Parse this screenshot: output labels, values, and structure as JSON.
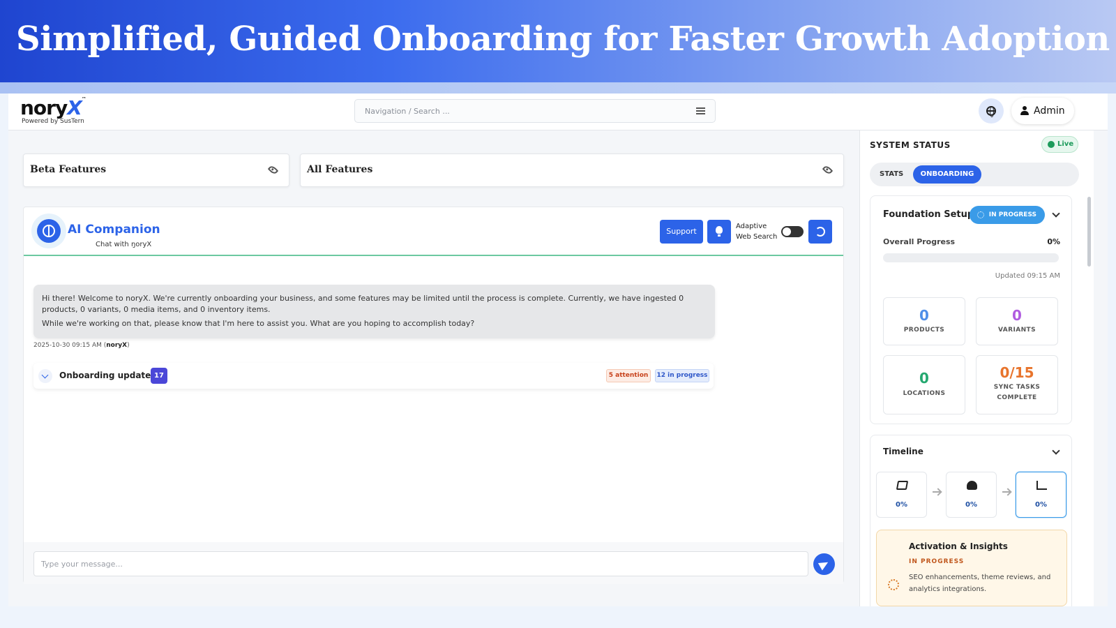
{
  "banner": {
    "title": "Simplified, Guided Onboarding for Faster Growth Adoption"
  },
  "header": {
    "logo_main": "nory",
    "logo_x": "X",
    "logo_tm": "™",
    "logo_sub": "Powered by SusTern",
    "search_placeholder": "Navigation / Search ...",
    "admin_label": "Admin"
  },
  "features": {
    "beta_label": "Beta Features",
    "all_label": "All Features"
  },
  "chat": {
    "title": "AI Companion",
    "subtitle": "Chat with ŋoryX",
    "support_label": "Support",
    "adaptive_label": "Adaptive Web Search",
    "adaptive_on": false,
    "message_line1": "Hi there! Welcome to noryX. We're currently onboarding your business, and some features may be limited until the process is complete. Currently, we have ingested 0 products, 0 variants, 0 media items, and 0 inventory items.",
    "message_line2": "While we're working on that, please know that I'm here to assist you. What are you hoping to accomplish today?",
    "meta_time": "2025-10-30 09:15 AM (",
    "meta_author": "noryX",
    "meta_close": ")",
    "updates_label": "Onboarding updates",
    "updates_count": "17",
    "attention_badge": "5 attention",
    "inprogress_badge": "12 in progress",
    "input_placeholder": "Type your message..."
  },
  "status": {
    "title": "SYSTEM STATUS",
    "live_label": "Live",
    "tab_stats": "STATS",
    "tab_onboarding": "ONBOARDING",
    "foundation_title": "Foundation Setup",
    "foundation_status": "IN PROGRESS",
    "overall_label": "Overall Progress",
    "overall_value": "0%",
    "overall_fraction": 0,
    "updated": "Updated 09:15 AM",
    "stats": [
      {
        "value": "0",
        "label": "PRODUCTS",
        "color": "#4f8fe8"
      },
      {
        "value": "0",
        "label": "VARIANTS",
        "color": "#b05ce0"
      },
      {
        "value": "0",
        "label": "LOCATIONS",
        "color": "#25a870"
      },
      {
        "value": "0/15",
        "label": "SYNC TASKS COMPLETE",
        "color": "#e8742c"
      }
    ],
    "timeline_title": "Timeline",
    "timeline_steps": [
      {
        "icon": "layers-icon",
        "pct": "0%"
      },
      {
        "icon": "cloud-download-icon",
        "pct": "0%"
      },
      {
        "icon": "chart-line-icon",
        "pct": "0%"
      }
    ],
    "activation_title": "Activation & Insights",
    "activation_status": "IN PROGRESS",
    "activation_desc": "SEO enhancements, theme reviews, and analytics integrations."
  }
}
